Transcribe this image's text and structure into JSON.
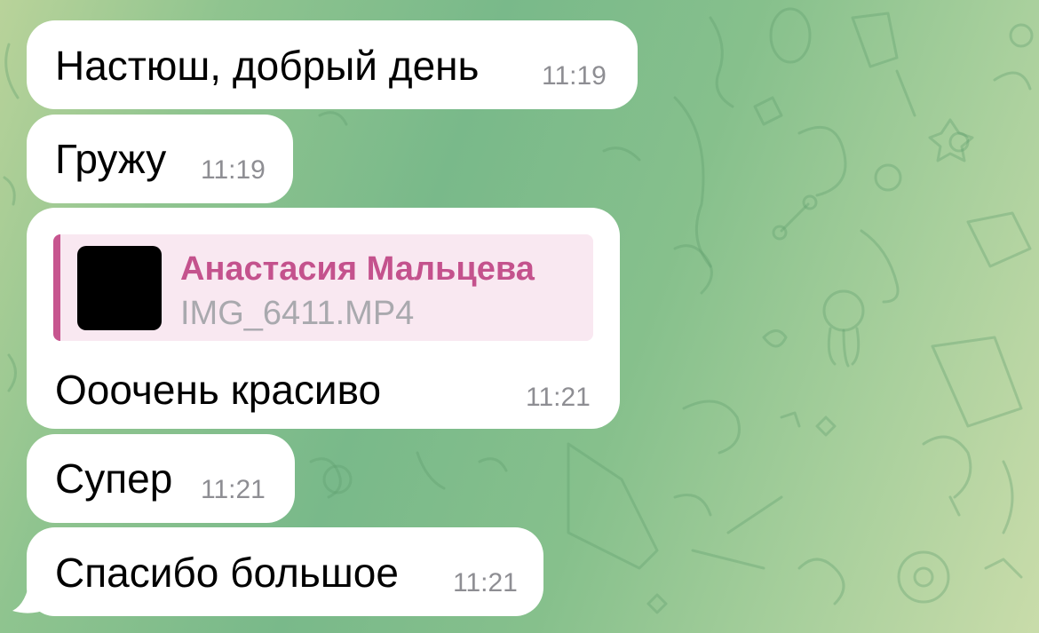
{
  "messages": [
    {
      "text": "Настюш, добрый день",
      "time": "11:19"
    },
    {
      "text": "Гружу",
      "time": "11:19"
    },
    {
      "reply": {
        "sender": "Анастасия Мальцева",
        "file": "IMG_6411.MP4"
      },
      "text": "Ооочень красиво",
      "time": "11:21"
    },
    {
      "text": "Супер",
      "time": "11:21"
    },
    {
      "text": "Спасибо большое",
      "time": "11:21"
    }
  ],
  "colors": {
    "bubble": "#ffffff",
    "reply_accent": "#c4528d",
    "reply_bg": "#f9e8f1",
    "time": "#8e8e93"
  }
}
